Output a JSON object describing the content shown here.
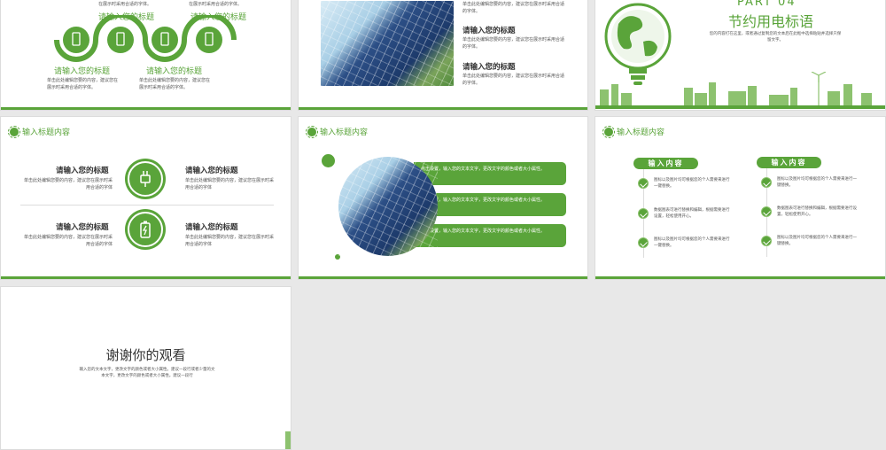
{
  "slide1": {
    "top_left_text": "在展示时采用合适的字体。",
    "top_right_text": "在展示时采用合适的字体。",
    "title_upper_left": "请输入您的标题",
    "title_upper_right": "请输入您的标题",
    "title_lower_left": "请输入您的标题",
    "title_lower_right": "请输入您的标题",
    "desc_lower_left": "单击此处编辑您要的内容，建议您在展示时采用合适的字体。",
    "desc_lower_right": "单击此处编辑您要的内容，建议您在展示时采用合适的字体。"
  },
  "slide2": {
    "top_text": "单击此处编辑您要的内容，建议您在展示时采用合适的字体。",
    "title_1": "请输入您的标题",
    "desc_1": "单击此处编辑您要的内容，建议您在展示时采用合适的字体。",
    "title_2": "请输入您的标题",
    "desc_2": "单击此处编辑您要的内容，建议您在展示时采用合适的字体。"
  },
  "slide3": {
    "part_label": "PART 04",
    "title": "节约用电标语",
    "desc": "您的内容打在这里，或者通过复制您的文本后在此框中选择粘贴并选择只保留文字。"
  },
  "slide4": {
    "header": "输入标题内容",
    "items": [
      {
        "title": "请输入您的标题",
        "desc": "单击此处编辑您要的内容，建议您在展示时采用合适的字体"
      },
      {
        "title": "请输入您的标题",
        "desc": "单击此处编辑您要的内容，建议您在展示时采用合适的字体"
      },
      {
        "title": "请输入您的标题",
        "desc": "单击此处编辑您要的内容，建议您在展示时采用合适的字体"
      },
      {
        "title": "请输入您的标题",
        "desc": "单击此处编辑您要的内容，建议您在展示时采用合适的字体"
      }
    ]
  },
  "slide5": {
    "header": "输入标题内容",
    "pills": [
      "点击设置，输入您的文本文字，更改文字的颜色或者大小属性。",
      "点击设置，输入您的文本文字，更改文字的颜色或者大小属性。",
      "点击设置，输入您的文本文字，更改文字的颜色或者大小属性。"
    ]
  },
  "slide6": {
    "header": "输入标题内容",
    "left_tag": "输入内容",
    "right_tag": "输入内容",
    "left_items": [
      "图标以及图片均可根据您的个人需要来进行一键替换。",
      "数据图表可进行替换和编辑，根据需要进行设置，轻松使用开心。",
      "图标以及图片均可根据您的个人需要来进行一键替换。"
    ],
    "right_items": [
      "图标以及图片均可根据您的个人需要来进行一键替换。",
      "数据图表可进行替换和编辑，根据需要进行设置，轻松使用开心。",
      "图标以及图片均可根据您的个人需要来进行一键替换。"
    ]
  },
  "slide7": {
    "title": "谢谢你的观看",
    "desc": "输入您的文本文字，更改文字的颜色或者大小属性。建议一段行或者少量的文本文字，更改文字的颜色或者大小属性。建议一段行"
  },
  "colors": {
    "accent": "#5aa43a",
    "background": "#e8e8e8"
  }
}
